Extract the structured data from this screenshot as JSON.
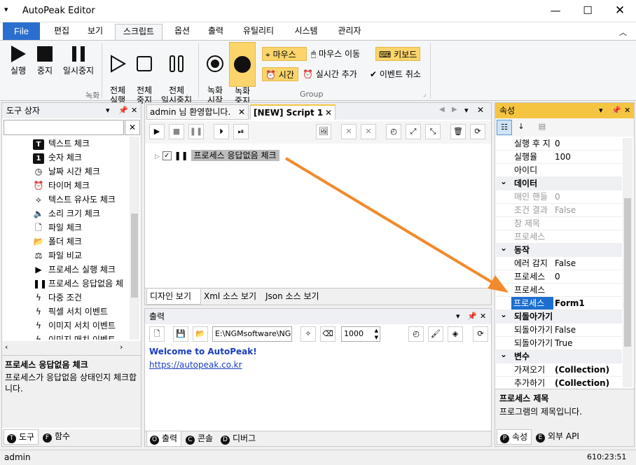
{
  "app": {
    "title": "AutoPeak Editor"
  },
  "ribbon_tabs": [
    "File",
    "편집",
    "보기",
    "스크립트",
    "옵션",
    "출력",
    "유틸리티",
    "시스템",
    "관리자"
  ],
  "ribbon": {
    "record_buttons": [
      {
        "label": "실행"
      },
      {
        "label": "중지"
      },
      {
        "label": "일시중지"
      },
      {
        "label": "전체\n실행"
      },
      {
        "label": "전체\n중지"
      },
      {
        "label": "전체\n일시중지"
      }
    ],
    "record_group": "녹화",
    "group_buttons": [
      {
        "label": "녹화\n시작"
      },
      {
        "label": "녹화\n중지"
      }
    ],
    "mouse": "마우스",
    "mouse_move": "마우스 이동",
    "keyboard": "키보드",
    "time": "시간",
    "realtime_add": "실시간 추가",
    "cancel_event": "이벤트 취소",
    "group_label": "Group"
  },
  "toolbox": {
    "title": "도구 상자",
    "items": [
      {
        "icon": "T",
        "label": "텍스트 체크"
      },
      {
        "icon": "1",
        "label": "숫자 체크"
      },
      {
        "icon": "clock",
        "label": "날짜 시간 체크"
      },
      {
        "icon": "alarm",
        "label": "타이머 체크"
      },
      {
        "icon": "fuzzy",
        "label": "텍스트 유사도 체크"
      },
      {
        "icon": "speaker",
        "label": "소리 크기 체크"
      },
      {
        "icon": "file",
        "label": "파일 체크"
      },
      {
        "icon": "folder",
        "label": "폴더 체크"
      },
      {
        "icon": "scale",
        "label": "파일 비교"
      },
      {
        "icon": "play",
        "label": "프로세스 실행 체크"
      },
      {
        "icon": "pause",
        "label": "프로세스 응답없음 체"
      },
      {
        "icon": "bolt",
        "label": "다중 조건"
      },
      {
        "icon": "bolt",
        "label": "픽셀 서치 이벤트"
      },
      {
        "icon": "bolt",
        "label": "이미지 서치 이벤트"
      },
      {
        "icon": "bolt",
        "label": "이미지 매치 이벤트"
      }
    ],
    "desc_title": "프로세스 응답없음 체크",
    "desc_text": "프로세스가 응답없음 상태인지 체크합니다.",
    "tabs": [
      "도구",
      "함수"
    ]
  },
  "doc_tabs": [
    "admin 님 환영합니다.",
    "[NEW] Script 1"
  ],
  "script": {
    "node": "프로세스 응답없음 체크"
  },
  "view_tabs": [
    "디자인 보기",
    "Xml 소스 보기",
    "Json 소스 보기"
  ],
  "output": {
    "title": "출력",
    "path": "E:\\NGMsoftware\\NG",
    "number": "1000",
    "lines": [
      "Welcome to AutoPeak!",
      "https://autopeak.co.kr"
    ],
    "tabs": [
      "출력",
      "콘솔",
      "디버그"
    ]
  },
  "props": {
    "title": "속성",
    "rows": [
      {
        "type": "row",
        "k": "실행 후 지",
        "v": "0"
      },
      {
        "type": "row",
        "k": "실행율",
        "v": "100"
      },
      {
        "type": "row",
        "k": "아이디",
        "v": ""
      },
      {
        "type": "cat",
        "k": "데이터"
      },
      {
        "type": "row",
        "k": "매인 핸들",
        "v": "0",
        "dim": true
      },
      {
        "type": "row",
        "k": "조건 결과",
        "v": "False",
        "dim": true
      },
      {
        "type": "row",
        "k": "창 제목",
        "v": "",
        "dim": true
      },
      {
        "type": "row",
        "k": "프로세스",
        "v": "",
        "dim": true
      },
      {
        "type": "cat",
        "k": "동작"
      },
      {
        "type": "row",
        "k": "에러 감지",
        "v": "False"
      },
      {
        "type": "row",
        "k": "프로세스",
        "v": "0"
      },
      {
        "type": "row",
        "k": "프로세스",
        "v": ""
      },
      {
        "type": "row",
        "k": "프로세스",
        "v": "Form1",
        "sel": true
      },
      {
        "type": "cat",
        "k": "되돌아가기"
      },
      {
        "type": "row",
        "k": "되돌아가기",
        "v": "False"
      },
      {
        "type": "row",
        "k": "되돌아가기",
        "v": "True"
      },
      {
        "type": "cat",
        "k": "변수"
      },
      {
        "type": "row",
        "k": "가져오기",
        "v": "(Collection)",
        "bold": true
      },
      {
        "type": "row",
        "k": "추가하기",
        "v": "(Collection)",
        "bold": true
      }
    ],
    "desc_title": "프로세스 제목",
    "desc_text": "프로그램의 제목입니다.",
    "tabs": [
      "속성",
      "외부 API"
    ]
  },
  "status": {
    "user": "admin",
    "time": "610:23:51"
  }
}
